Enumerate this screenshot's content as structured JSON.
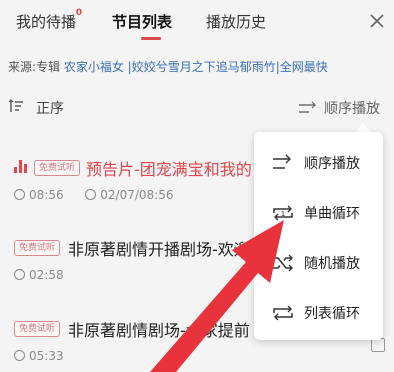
{
  "tabs": [
    {
      "label": "我的待播",
      "dot": "0"
    },
    {
      "label": "节目列表"
    },
    {
      "label": "播放历史"
    }
  ],
  "source": {
    "prefix": "来源:专辑 ",
    "album": "农家小福女 |姣姣兮雪月之下追马郁雨竹|全网最快"
  },
  "toolbar": {
    "order_label": "正序",
    "mode_label": "顺序播放"
  },
  "episodes": [
    {
      "badge": "免费试听",
      "title": "预告片-团宠满宝和我的",
      "time": "08:56",
      "date": "02/07/08:56",
      "playing": true
    },
    {
      "badge": "免费试听",
      "title": "非原著剧情开播剧场-欢迎",
      "time": "02:58"
    },
    {
      "badge": "免费试听",
      "title": "非原著剧情剧场-大家提前",
      "time": "05:33"
    }
  ],
  "menu": {
    "items": [
      {
        "label": "顺序播放",
        "icon": "sequential-icon"
      },
      {
        "label": "单曲循环",
        "icon": "repeat-one-icon",
        "icon_text": "1"
      },
      {
        "label": "随机播放",
        "icon": "shuffle-icon"
      },
      {
        "label": "列表循环",
        "icon": "repeat-all-icon"
      }
    ]
  },
  "colors": {
    "accent": "#e0474c",
    "link": "#3b6fb6",
    "annotation_arrow": "#e8323c"
  }
}
